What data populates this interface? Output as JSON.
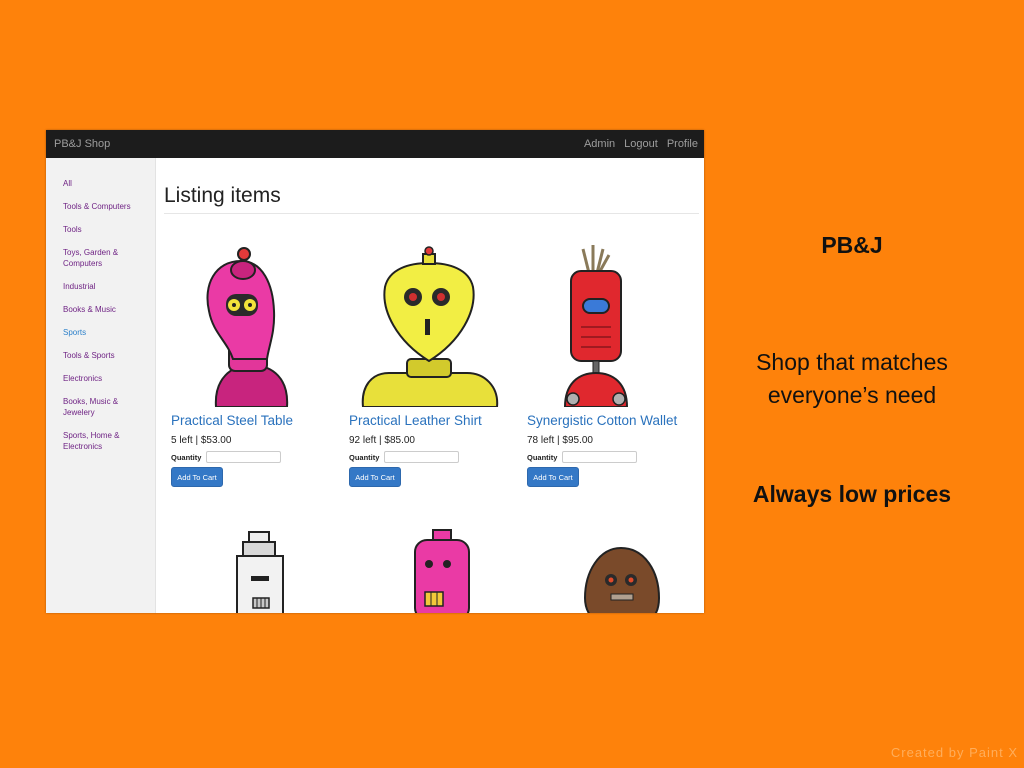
{
  "colors": {
    "slide_bg": "#fe820b",
    "navbar_bg": "#1c1c1c",
    "link_blue": "#2a72bd",
    "button_blue": "#3478c6",
    "category_purple": "#6f2384"
  },
  "shop": {
    "brand": "PB&J Shop",
    "nav": {
      "admin": "Admin",
      "logout": "Logout",
      "profile": "Profile"
    },
    "sidebar": {
      "items": [
        {
          "label": "All"
        },
        {
          "label": "Tools & Computers"
        },
        {
          "label": "Tools"
        },
        {
          "label": "Toys, Garden & Computers"
        },
        {
          "label": "Industrial"
        },
        {
          "label": "Books & Music"
        },
        {
          "label": "Sports"
        },
        {
          "label": "Tools & Sports"
        },
        {
          "label": "Electronics"
        },
        {
          "label": "Books, Music & Jewelery"
        },
        {
          "label": "Sports, Home & Electronics"
        }
      ],
      "active": "Sports"
    },
    "heading": "Listing items",
    "products": [
      {
        "name": "Practical Steel Table",
        "stock": "5 left | $53.00",
        "quantity_label": "Quantity",
        "button": "Add To Cart",
        "image": "pink-robot"
      },
      {
        "name": "Practical Leather Shirt",
        "stock": "92 left | $85.00",
        "quantity_label": "Quantity",
        "button": "Add To Cart",
        "image": "yellow-robot"
      },
      {
        "name": "Synergistic Cotton Wallet",
        "stock": "78 left | $95.00",
        "quantity_label": "Quantity",
        "button": "Add To Cart",
        "image": "red-robot"
      }
    ],
    "row2_images": [
      "white-robot",
      "pink-robot-2",
      "brown-robot"
    ]
  },
  "slide": {
    "title": "PB&J",
    "tagline_1": "Shop that matches",
    "tagline_2": "everyone’s need",
    "slogan": "Always low prices",
    "credit": "Created by Paint X"
  }
}
